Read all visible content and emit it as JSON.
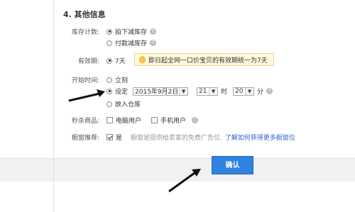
{
  "section": {
    "title": "4. 其他信息"
  },
  "stock": {
    "label": "库存计数:",
    "options": [
      {
        "label": "拍下减库存",
        "selected": true
      },
      {
        "label": "付款减库存",
        "selected": false
      }
    ]
  },
  "validity": {
    "label": "有效期:",
    "option": "7天",
    "notice": "即日起全网一口价宝贝的有效期统一为7天"
  },
  "start_time": {
    "label": "开始时间:",
    "now_label": "立刻",
    "set_label": "设定",
    "date_value": "2015年9月2日",
    "hour_value": "21",
    "hour_unit": "时",
    "minute_value": "20",
    "minute_unit": "分",
    "warehouse_label": "放入仓库"
  },
  "flash_sale": {
    "label": "秒杀商品:",
    "options": [
      {
        "label": "电脑用户",
        "checked": false
      },
      {
        "label": "手机用户",
        "checked": false
      }
    ]
  },
  "showcase": {
    "label": "橱窗推荐:",
    "option": "是",
    "desc": "橱窗是提供给卖家的免费广告位,",
    "link": "了解如何获得更多橱窗位"
  },
  "confirm_label": "确认",
  "colors": {
    "accent": "#2f82e0",
    "link": "#3366cc",
    "notice_bg": "#fff8dc"
  }
}
